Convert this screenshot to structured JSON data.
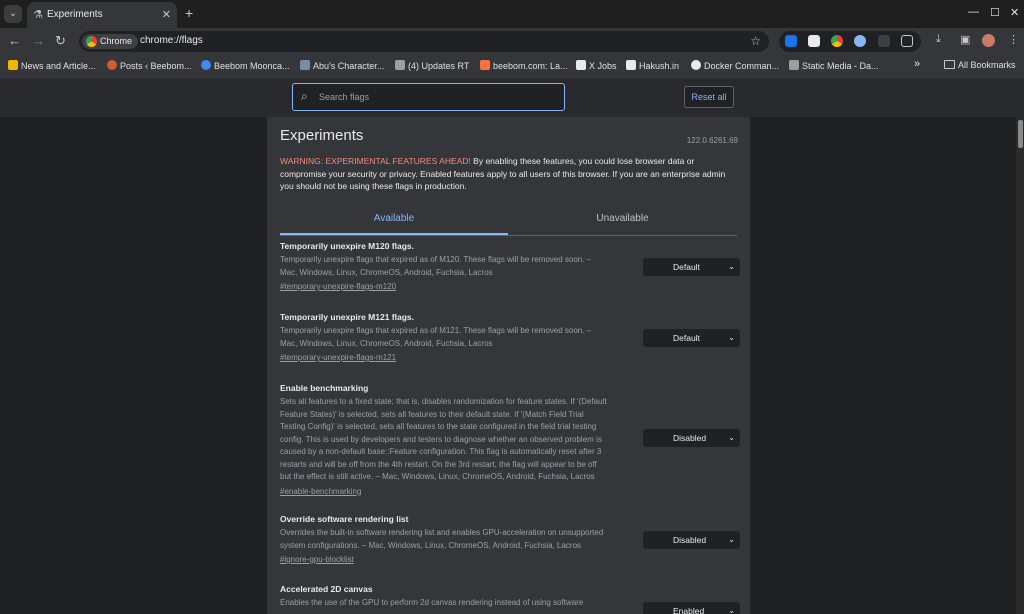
{
  "tabstrip": {
    "tab_title": "Experiments",
    "new_tab": "+",
    "close": "✕"
  },
  "toolbar": {
    "chrome_chip": "Chrome",
    "url": "chrome://flags"
  },
  "bookmarks": [
    {
      "label": "News and Article...",
      "color": "#f4b400"
    },
    {
      "label": "Posts ‹ Beebom...",
      "color": "#d65a31"
    },
    {
      "label": "Beebom Mooncа...",
      "color": "#4285f4"
    },
    {
      "label": "Abu's Character...",
      "color": "#7b8ca8"
    },
    {
      "label": "(4) Updates RT",
      "color": "#9e9e9e"
    },
    {
      "label": "beebom.com: La...",
      "color": "#ff6f3c"
    },
    {
      "label": "X Jobs",
      "color": "#e8eaed"
    },
    {
      "label": "Hakush.in",
      "color": "#e8eaed"
    },
    {
      "label": "Docker Comman...",
      "color": "#e8eaed"
    },
    {
      "label": "Static Media - Da...",
      "color": "#9e9e9e"
    }
  ],
  "bookmarks_more": "»",
  "all_bookmarks": "All Bookmarks",
  "search": {
    "placeholder": "Search flags"
  },
  "reset_label": "Reset all",
  "page": {
    "title": "Experiments",
    "version": "122.0.6261.69",
    "warning_strong": "WARNING: EXPERIMENTAL FEATURES AHEAD!",
    "warning_text": " By enabling these features, you could lose browser data or compromise your security or privacy. Enabled features apply to all users of this browser. If you are an enterprise admin you should not be using these flags in production.",
    "tab_available": "Available",
    "tab_unavailable": "Unavailable"
  },
  "flags": [
    {
      "title": "Temporarily unexpire M120 flags.",
      "desc": "Temporarily unexpire flags that expired as of M120. These flags will be removed soon. – Mac, Windows, Linux, ChromeOS, Android, Fuchsia, Lacros",
      "link": "#temporary-unexpire-flags-m120",
      "value": "Default"
    },
    {
      "title": "Temporarily unexpire M121 flags.",
      "desc": "Temporarily unexpire flags that expired as of M121. These flags will be removed soon. – Mac, Windows, Linux, ChromeOS, Android, Fuchsia, Lacros",
      "link": "#temporary-unexpire-flags-m121",
      "value": "Default"
    },
    {
      "title": "Enable benchmarking",
      "desc": "Sets all features to a fixed state; that is, disables randomization for feature states. If '(Default Feature States)' is selected, sets all features to their default state. If '(Match Field Trial Testing Config)' is selected, sets all features to the state configured in the field trial testing config. This is used by developers and testers to diagnose whether an observed problem is caused by a non-default base::Feature configuration. This flag is automatically reset after 3 restarts and will be off from the 4th restart. On the 3rd restart, the flag will appear to be off but the effect is still active. – Mac, Windows, Linux, ChromeOS, Android, Fuchsia, Lacros",
      "link": "#enable-benchmarking",
      "value": "Disabled"
    },
    {
      "title": "Override software rendering list",
      "desc": "Overrides the built-in software rendering list and enables GPU-acceleration on unsupported system configurations. – Mac, Windows, Linux, ChromeOS, Android, Fuchsia, Lacros",
      "link": "#ignore-gpu-blocklist",
      "value": "Disabled"
    },
    {
      "title": "Accelerated 2D canvas",
      "desc": "Enables the use of the GPU to perform 2d canvas rendering instead of using software",
      "link": "",
      "value": "Enabled"
    }
  ],
  "colors": {
    "accent": "#8ab4f8",
    "warning": "#f28b82",
    "page_bg": "#202124",
    "panel_bg": "#35363a"
  }
}
